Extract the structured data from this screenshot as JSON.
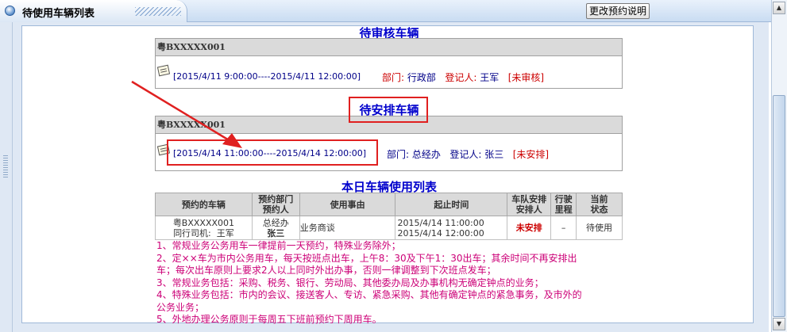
{
  "window": {
    "title": "待使用车辆列表",
    "explain_button": "更改预约说明"
  },
  "pending_review": {
    "heading": "待审核车辆",
    "plate": "粤BXXXXX001",
    "period": "[2015/4/11 9:00:00----2015/4/11 12:00:00]",
    "dept_label": "部门:",
    "dept": "行政部",
    "registrant_label": "登记人:",
    "registrant": "王军",
    "status": "[未审核]"
  },
  "pending_arrange": {
    "heading": "待安排车辆",
    "plate": "粤BXXXXX001",
    "period": "[2015/4/14 11:00:00----2015/4/14 12:00:00]",
    "dept_label": "部门:",
    "dept": "总经办",
    "registrant_label": "登记人:",
    "registrant": "张三",
    "status": "[未安排]"
  },
  "today_usage": {
    "heading": "本日车辆使用列表",
    "columns": {
      "vehicle": "预约的车辆",
      "dept_line1": "预约部门",
      "dept_line2": "预约人",
      "reason": "使用事由",
      "time": "起止时间",
      "fleet_line1": "车队安排",
      "fleet_line2": "安排人",
      "mileage_line1": "行驶",
      "mileage_line2": "里程",
      "status_line1": "当前",
      "status_line2": "状态"
    },
    "row": {
      "plate": "粤BXXXXX001",
      "driver_label": "同行司机:",
      "driver": "王军",
      "dept": "总经办",
      "person": "张三",
      "reason": "业务商谈",
      "start": "2015/4/14 11:00:00",
      "end": "2015/4/14 12:00:00",
      "fleet": "未安排",
      "mileage": "–",
      "status": "待使用"
    }
  },
  "rules": [
    "1、常规业务公务用车一律提前一天预约，特殊业务除外；",
    "2、定××车为市内公务用车，每天按班点出车，上午8：30及下午1：30出车；其余时间不再安排出",
    "车；每次出车原则上要求2人以上同时外出办事，否则一律调整到下次班点发车；",
    "3、常规业务包括：采购、税务、银行、劳动局、其他委办局及办事机构无确定钟点的业务；",
    "4、特殊业务包括：市内的会议、接送客人、专访、紧急采购、其他有确定钟点的紧急事务，及市外的",
    "公务业务；",
    "5、外地办理公务原则于每周五下班前预约下周用车。"
  ],
  "colors": {
    "heading": "#0000cc",
    "rules_text": "#cc0077",
    "annotation": "#e02020",
    "status_red": "#cc0000"
  }
}
